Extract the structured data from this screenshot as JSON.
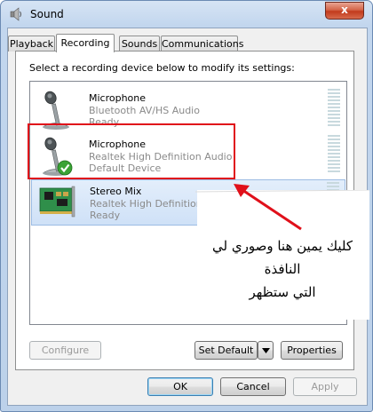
{
  "window": {
    "title": "Sound",
    "close_label": "x"
  },
  "tabs": [
    {
      "label": "Playback",
      "active": false
    },
    {
      "label": "Recording",
      "active": true
    },
    {
      "label": "Sounds",
      "active": false
    },
    {
      "label": "Communications",
      "active": false
    }
  ],
  "instruction": "Select a recording device below to modify its settings:",
  "devices": [
    {
      "name": "Microphone",
      "line1": "Bluetooth AV/HS Audio",
      "line2": "Ready",
      "icon": "microphone-icon",
      "selected": false,
      "default": false
    },
    {
      "name": "Microphone",
      "line1": "Realtek High Definition Audio",
      "line2": "Default Device",
      "icon": "microphone-icon",
      "selected": false,
      "default": true
    },
    {
      "name": "Stereo Mix",
      "line1": "Realtek High Definition Audio",
      "line2": "Ready",
      "icon": "sound-card-icon",
      "selected": true,
      "default": false
    }
  ],
  "buttons": {
    "configure": "Configure",
    "set_default": "Set Default",
    "properties": "Properties",
    "ok": "OK",
    "cancel": "Cancel",
    "apply": "Apply"
  },
  "annotation": {
    "text_line1": "كليك يمين هنا وصوري لي النافذة",
    "text_line2": "التي ستظهر",
    "box_color": "#e0101a",
    "arrow_color": "#e0101a"
  },
  "colors": {
    "title_bar": "#c2d6ee",
    "selection": "#cfe1f7",
    "default_check": "#3aa335"
  }
}
